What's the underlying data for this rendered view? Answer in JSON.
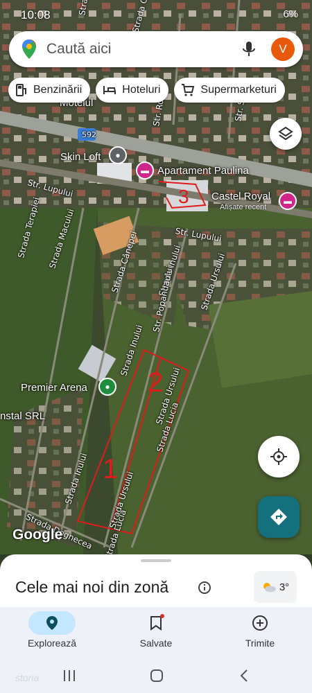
{
  "status_bar": {
    "time": "10:08",
    "battery": "6%"
  },
  "search": {
    "placeholder": "Caută aici",
    "avatar_letter": "V"
  },
  "chips": [
    {
      "label": "Benzinării",
      "icon": "gas-station-icon"
    },
    {
      "label": "Hoteluri",
      "icon": "hotel-icon"
    },
    {
      "label": "Supermarketuri",
      "icon": "shopping-cart-icon"
    }
  ],
  "map": {
    "route_shield": "592",
    "pois": {
      "motel": "Motelul",
      "skin_loft": "Skin Loft",
      "apartament": "Apartament Paulina",
      "castel": "Castel Royal",
      "castel_sub": "Afișate recent",
      "arena": "Premier Arena",
      "instal": "nstal SRL"
    },
    "streets": {
      "oslo": "Strada Oslo",
      "roma": "Str. Roma",
      "s1": "Stra",
      "s2": "Str. S",
      "lupului_w": "Str. Lupului",
      "lupului_e": "Str. Lupului",
      "terapiei": "Strada Terapiei",
      "macului": "Strada Macului",
      "canepei": "Strada Cânepei",
      "inului_n": "Strada Inului",
      "popandaului": "Str. Popandaului",
      "ursului_n": "Strada Ursului",
      "inului_m": "Strada Inului",
      "ursului_m": "Strada Ursului",
      "lucia_n": "Strada Lucia",
      "inului_s": "Strada Inului",
      "ursului_s": "Strada Ursului",
      "dognecea": "Strada Dognecea",
      "lucia_s": "Strada Lucia"
    },
    "annotations": {
      "num1": "1",
      "num2": "2",
      "num3": "3"
    },
    "attribution": "Google"
  },
  "sheet": {
    "title": "Cele mai noi din zonă",
    "temperature": "3°"
  },
  "nav": [
    {
      "label": "Explorează",
      "active": true
    },
    {
      "label": "Salvate",
      "active": false
    },
    {
      "label": "Trimite",
      "active": false
    }
  ],
  "watermark": "storia",
  "colors": {
    "accent_teal": "#15707e",
    "pin_pink": "#d0268a",
    "avatar": "#e8590c",
    "annotation_red": "#e01b1b"
  }
}
